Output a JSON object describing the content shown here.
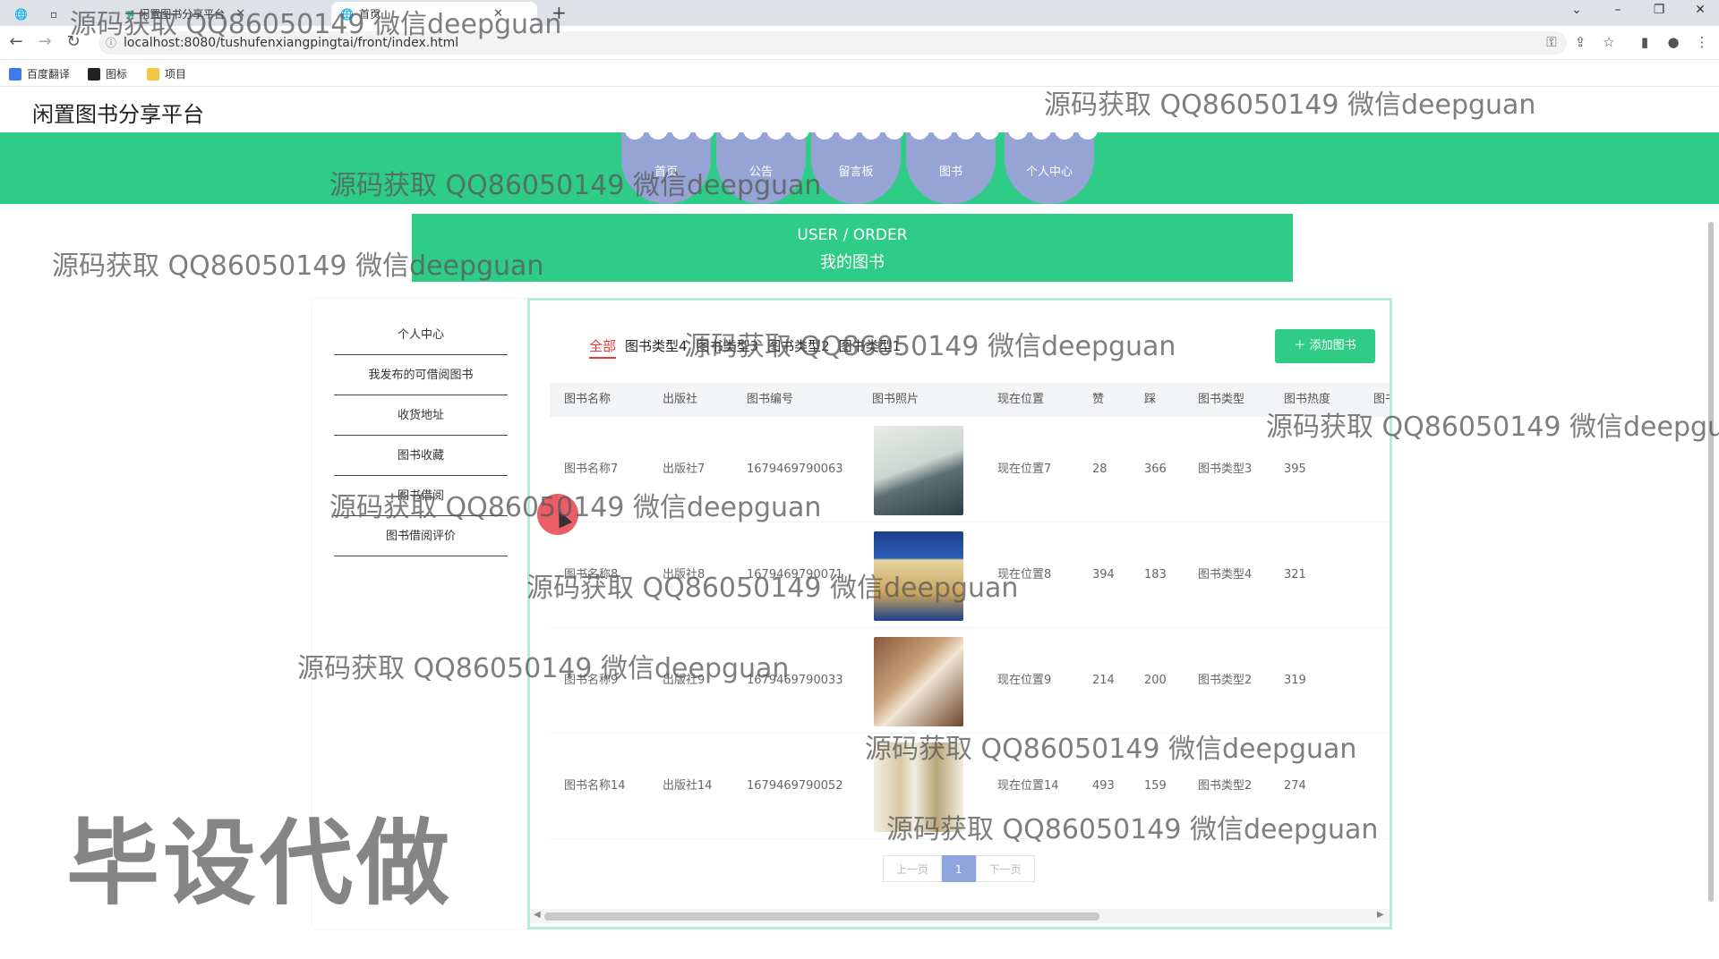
{
  "browser": {
    "tabs": [
      {
        "label": ""
      },
      {
        "label": "闲置图书分享平台"
      },
      {
        "label": "首页"
      }
    ],
    "url": "localhost:8080/tushufenxiangpingtai/front/index.html",
    "bookmarks": [
      {
        "label": "百度翻译",
        "color": "#3b7bea"
      },
      {
        "label": "图标",
        "color": "#222222"
      },
      {
        "label": "项目",
        "color": "#f4c542"
      }
    ]
  },
  "site": {
    "title": "闲置图书分享平台"
  },
  "nav": {
    "items": [
      {
        "label": "首页"
      },
      {
        "label": "公告"
      },
      {
        "label": "留言板"
      },
      {
        "label": "图书"
      },
      {
        "label": "个人中心"
      }
    ]
  },
  "banner": {
    "en": "USER / ORDER",
    "zh": "我的图书"
  },
  "sidebar": {
    "items": [
      {
        "label": "个人中心"
      },
      {
        "label": "我发布的可借阅图书"
      },
      {
        "label": "收货地址"
      },
      {
        "label": "图书收藏"
      },
      {
        "label": "图书借阅"
      },
      {
        "label": "图书借阅评价"
      }
    ]
  },
  "filters": [
    {
      "label": "全部",
      "active": true
    },
    {
      "label": "图书类型4"
    },
    {
      "label": "图书类型3"
    },
    {
      "label": "图书类型2"
    },
    {
      "label": "图书类型1"
    }
  ],
  "add_button": {
    "label": "添加图书"
  },
  "table": {
    "headers": [
      "图书名称",
      "出版社",
      "图书编号",
      "图书照片",
      "现在位置",
      "赞",
      "踩",
      "图书类型",
      "图书热度",
      "图书"
    ],
    "rows": [
      {
        "name": "图书名称7",
        "publisher": "出版社7",
        "code": "1679469790063",
        "location": "现在位置7",
        "likes": "28",
        "dislikes": "366",
        "type": "图书类型3",
        "heat": "395"
      },
      {
        "name": "图书名称8",
        "publisher": "出版社8",
        "code": "1679469790071",
        "location": "现在位置8",
        "likes": "394",
        "dislikes": "183",
        "type": "图书类型4",
        "heat": "321"
      },
      {
        "name": "图书名称9",
        "publisher": "出版社9",
        "code": "1679469790033",
        "location": "现在位置9",
        "likes": "214",
        "dislikes": "200",
        "type": "图书类型2",
        "heat": "319"
      },
      {
        "name": "图书名称14",
        "publisher": "出版社14",
        "code": "1679469790052",
        "location": "现在位置14",
        "likes": "493",
        "dislikes": "159",
        "type": "图书类型2",
        "heat": "274"
      }
    ]
  },
  "pager": {
    "prev": "上一页",
    "current": "1",
    "next": "下一页"
  },
  "watermark": {
    "text": "源码获取 QQ86050149 微信deepguan",
    "big": "毕设代做"
  }
}
